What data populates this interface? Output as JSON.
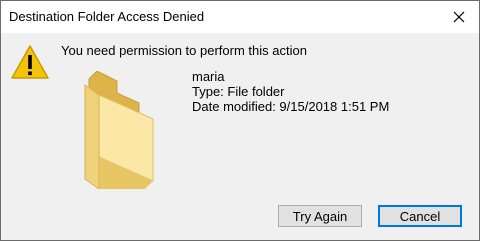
{
  "window": {
    "title": "Destination Folder Access Denied",
    "close_icon": "close-icon"
  },
  "content": {
    "warning_icon": "warning-icon",
    "message": "You need permission to perform this action",
    "folder_icon": "folder-icon",
    "item": {
      "name": "maria",
      "type": "Type: File folder",
      "date_modified": "Date modified: 9/15/2018 1:51 PM"
    }
  },
  "buttons": {
    "try_again": "Try Again",
    "cancel": "Cancel"
  },
  "colors": {
    "warning": "#f5c20a",
    "folder": "#e8c663",
    "focus_border": "#0078d7"
  }
}
